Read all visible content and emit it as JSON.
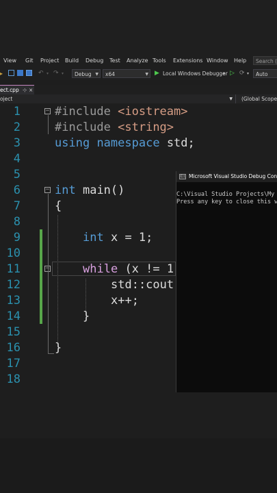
{
  "menu": {
    "view": "View",
    "git": "Git",
    "project": "Project",
    "build": "Build",
    "debug": "Debug",
    "test": "Test",
    "analyze": "Analyze",
    "tools": "Tools",
    "extensions": "Extensions",
    "window": "Window",
    "help": "Help",
    "search_placeholder": "Search (C"
  },
  "toolbar": {
    "configuration": "Debug",
    "platform": "x64",
    "run_label": "Local Windows Debugger",
    "auto": "Auto"
  },
  "tab": {
    "filename": "ect.cpp",
    "pin": "⊹",
    "close": "×"
  },
  "navbar": {
    "project": "oject",
    "scope": "(Global Scope)"
  },
  "editor": {
    "line_numbers": [
      "1",
      "2",
      "3",
      "4",
      "5",
      "6",
      "7",
      "8",
      "9",
      "10",
      "11",
      "12",
      "13",
      "14",
      "15",
      "16",
      "17",
      "18"
    ],
    "code": {
      "l1_directive": "#include",
      "l1_header": "<iostream>",
      "l2_directive": "#include",
      "l2_header": "<string>",
      "l3_kw1": "using",
      "l3_kw2": "namespace",
      "l3_rest": "std;",
      "l6_kw": "int",
      "l6_rest": "main()",
      "l7": "{",
      "l9_kw": "int",
      "l9_rest": "x = 1;",
      "l11_kw": "while",
      "l11_rest": "(x != 1",
      "l12": "std::cout",
      "l13": "x++;",
      "l14": "}",
      "l16": "}"
    }
  },
  "console": {
    "title": "Microsoft Visual Studio Debug Console",
    "icon_label": "C:\\",
    "line1": "C:\\Visual Studio Projects\\My P",
    "line2": "Press any key to close this wi"
  },
  "colors": {
    "keyword": "#569cd6",
    "preprocessor": "#9b9b9b",
    "include_string": "#d69d85",
    "line_number": "#2b91af",
    "change_bar": "#57a64a",
    "run_arrow": "#4ec94e"
  }
}
